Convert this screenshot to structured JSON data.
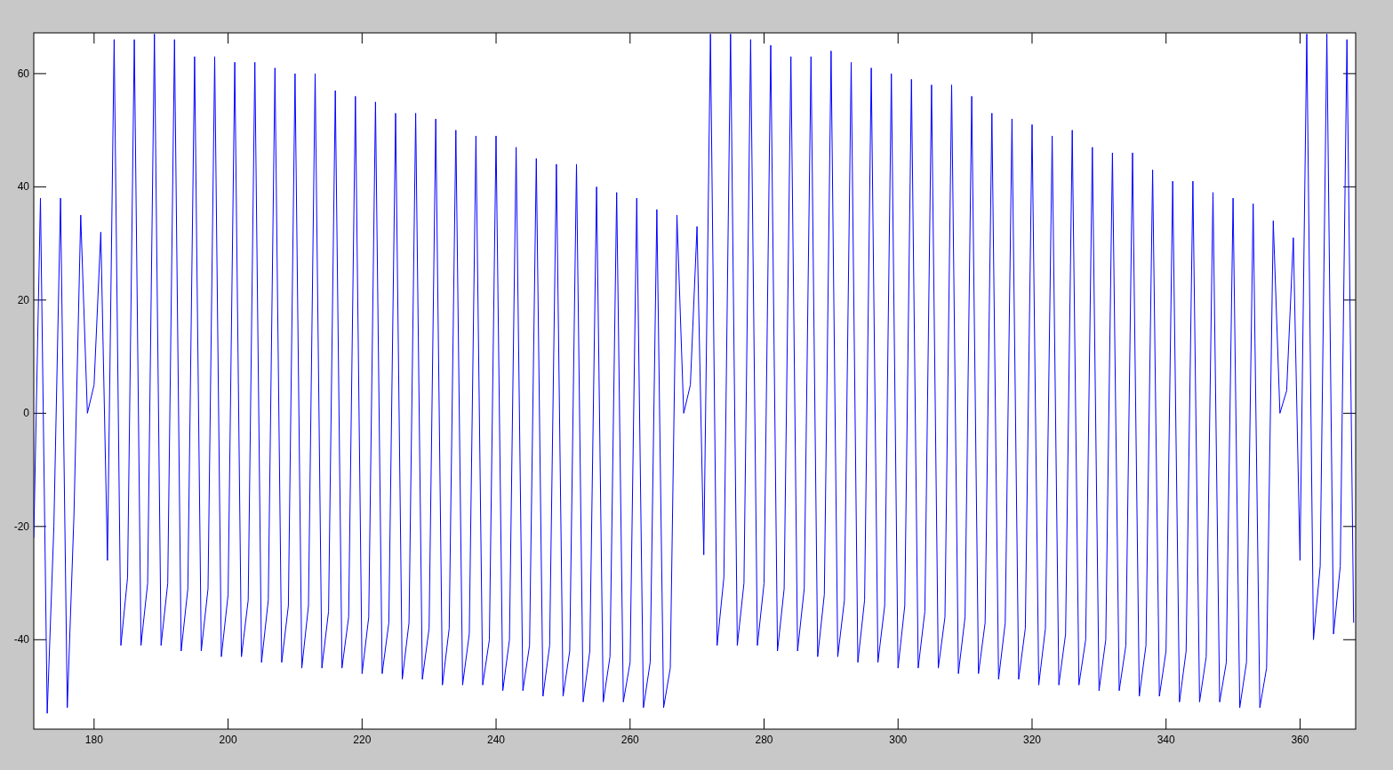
{
  "figure": {
    "chart_data": {
      "type": "line",
      "xlim": [
        171.0,
        368.3
      ],
      "ylim": [
        -55.8,
        67.2
      ],
      "xticks": [
        180,
        200,
        220,
        240,
        260,
        280,
        300,
        320,
        340,
        360
      ],
      "yticks": [
        -40,
        -20,
        0,
        20,
        40,
        60
      ],
      "x": [
        171,
        172,
        173,
        174,
        175,
        176,
        177,
        178,
        179,
        180,
        181,
        182,
        183,
        184,
        185,
        186,
        187,
        188,
        189,
        190,
        191,
        192,
        193,
        194,
        195,
        196,
        197,
        198,
        199,
        200,
        201,
        202,
        203,
        204,
        205,
        206,
        207,
        208,
        209,
        210,
        211,
        212,
        213,
        214,
        215,
        216,
        217,
        218,
        219,
        220,
        221,
        222,
        223,
        224,
        225,
        226,
        227,
        228,
        229,
        230,
        231,
        232,
        233,
        234,
        235,
        236,
        237,
        238,
        239,
        240,
        241,
        242,
        243,
        244,
        245,
        246,
        247,
        248,
        249,
        250,
        251,
        252,
        253,
        254,
        255,
        256,
        257,
        258,
        259,
        260,
        261,
        262,
        263,
        264,
        265,
        266,
        267,
        268,
        269,
        270,
        271,
        272,
        273,
        274,
        275,
        276,
        277,
        278,
        279,
        280,
        281,
        282,
        283,
        284,
        285,
        286,
        287,
        288,
        289,
        290,
        291,
        292,
        293,
        294,
        295,
        296,
        297,
        298,
        299,
        300,
        301,
        302,
        303,
        304,
        305,
        306,
        307,
        308,
        309,
        310,
        311,
        312,
        313,
        314,
        315,
        316,
        317,
        318,
        319,
        320,
        321,
        322,
        323,
        324,
        325,
        326,
        327,
        328,
        329,
        330,
        331,
        332,
        333,
        334,
        335,
        336,
        337,
        338,
        339,
        340,
        341,
        342,
        343,
        344,
        345,
        346,
        347,
        348,
        349,
        350,
        351,
        352,
        353,
        354,
        355,
        356,
        357,
        358,
        359,
        360,
        361,
        362,
        363,
        364,
        365,
        366,
        367,
        368
      ],
      "series": [
        {
          "color": "#0000ff",
          "values": [
            -22,
            38,
            -53,
            -20,
            38,
            -52,
            -18,
            35,
            0,
            5,
            32,
            -26,
            66,
            -41,
            -29,
            66,
            -41,
            -30,
            67,
            -41,
            -30,
            66,
            -42,
            -31,
            63,
            -42,
            -31,
            63,
            -43,
            -32,
            62,
            -43,
            -33,
            62,
            -44,
            -33,
            61,
            -44,
            -34,
            60,
            -45,
            -34,
            60,
            -45,
            -35,
            57,
            -45,
            -36,
            56,
            -46,
            -36,
            55,
            -46,
            -37,
            53,
            -47,
            -37,
            53,
            -47,
            -38,
            52,
            -48,
            -38,
            50,
            -48,
            -39,
            49,
            -48,
            -40,
            49,
            -49,
            -40,
            47,
            -49,
            -41,
            45,
            -50,
            -41,
            44,
            -50,
            -42,
            44,
            -51,
            -42,
            40,
            -51,
            -43,
            39,
            -51,
            -44,
            38,
            -52,
            -44,
            36,
            -52,
            -45,
            35,
            0,
            5,
            33,
            -25,
            67,
            -41,
            -29,
            67,
            -41,
            -30,
            66,
            -41,
            -30,
            65,
            -42,
            -31,
            63,
            -42,
            -31,
            63,
            -43,
            -32,
            64,
            -43,
            -33,
            62,
            -44,
            -33,
            61,
            -44,
            -34,
            60,
            -45,
            -34,
            59,
            -45,
            -35,
            58,
            -45,
            -36,
            58,
            -46,
            -36,
            56,
            -46,
            -37,
            53,
            -47,
            -37,
            52,
            -47,
            -38,
            51,
            -48,
            -38,
            49,
            -48,
            -39,
            50,
            -48,
            -40,
            47,
            -49,
            -40,
            46,
            -49,
            -41,
            46,
            -50,
            -41,
            43,
            -50,
            -42,
            41,
            -51,
            -42,
            41,
            -51,
            -43,
            39,
            -51,
            -44,
            38,
            -52,
            -44,
            37,
            -52,
            -45,
            34,
            0,
            4,
            31,
            -26,
            67,
            -40,
            -27,
            67,
            -39,
            -27,
            66,
            -37
          ]
        }
      ]
    }
  }
}
